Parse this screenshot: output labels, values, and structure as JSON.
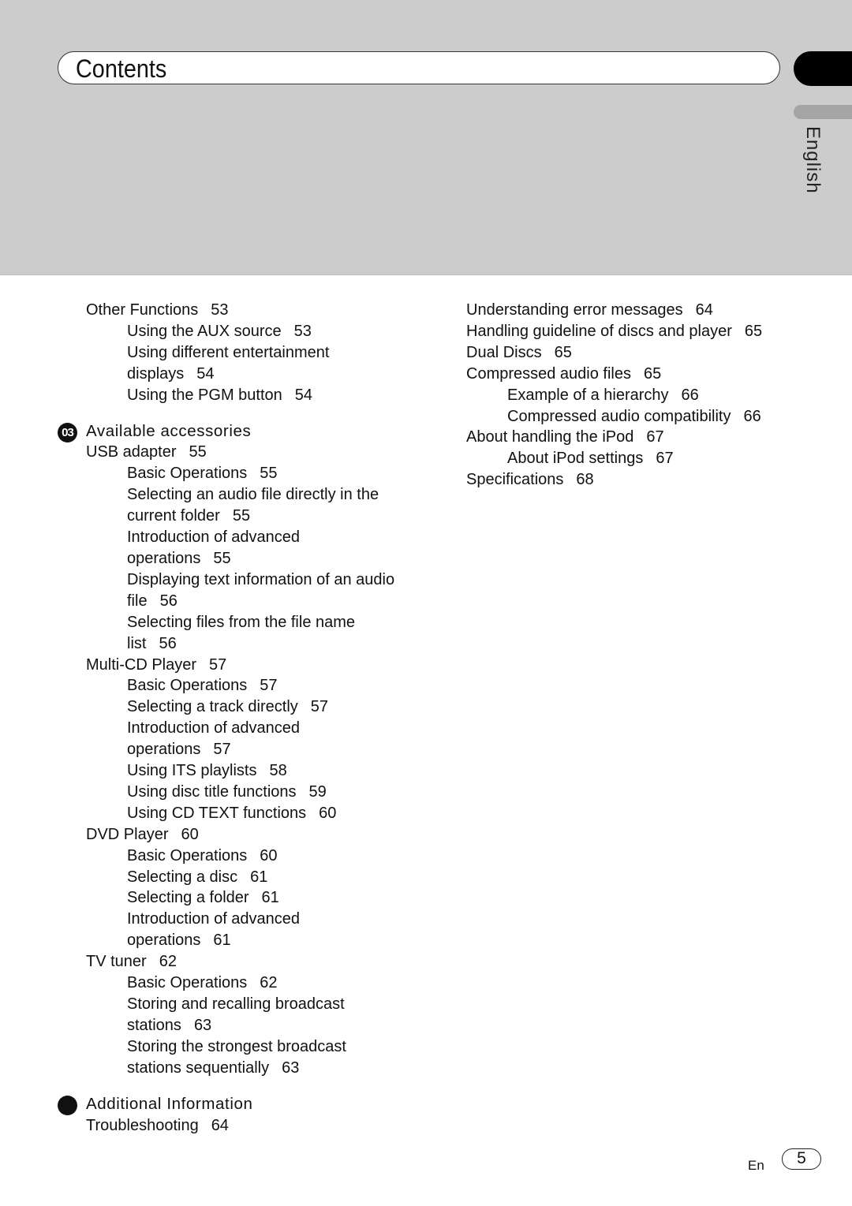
{
  "header": {
    "title": "Contents",
    "language_tab": "English"
  },
  "left_column": [
    {
      "type": "entry",
      "level": 1,
      "text": "Other Functions",
      "page": "53"
    },
    {
      "type": "entry",
      "level": 2,
      "text": "Using the AUX source",
      "page": "53"
    },
    {
      "type": "entry",
      "level": 2,
      "text": "Using different entertainment\ndisplays",
      "page": "54"
    },
    {
      "type": "entry",
      "level": 2,
      "text": "Using the PGM button",
      "page": "54"
    },
    {
      "type": "section",
      "badge": "03",
      "text": "Available accessories"
    },
    {
      "type": "entry",
      "level": 1,
      "text": "USB adapter",
      "page": "55"
    },
    {
      "type": "entry",
      "level": 2,
      "text": "Basic Operations",
      "page": "55"
    },
    {
      "type": "entry",
      "level": 2,
      "text": "Selecting an audio file directly in the\ncurrent folder",
      "page": "55"
    },
    {
      "type": "entry",
      "level": 2,
      "text": "Introduction of advanced\noperations",
      "page": "55"
    },
    {
      "type": "entry",
      "level": 2,
      "text": "Displaying text information of an audio\nfile",
      "page": "56"
    },
    {
      "type": "entry",
      "level": 2,
      "text": "Selecting files from the file name\nlist",
      "page": "56"
    },
    {
      "type": "entry",
      "level": 1,
      "text": "Multi-CD Player",
      "page": "57"
    },
    {
      "type": "entry",
      "level": 2,
      "text": "Basic Operations",
      "page": "57"
    },
    {
      "type": "entry",
      "level": 2,
      "text": "Selecting a track directly",
      "page": "57"
    },
    {
      "type": "entry",
      "level": 2,
      "text": "Introduction of advanced\noperations",
      "page": "57"
    },
    {
      "type": "entry",
      "level": 2,
      "text": "Using ITS playlists",
      "page": "58"
    },
    {
      "type": "entry",
      "level": 2,
      "text": "Using disc title functions",
      "page": "59"
    },
    {
      "type": "entry",
      "level": 2,
      "text": "Using CD TEXT functions",
      "page": "60"
    },
    {
      "type": "entry",
      "level": 1,
      "text": "DVD Player",
      "page": "60"
    },
    {
      "type": "entry",
      "level": 2,
      "text": "Basic Operations",
      "page": "60"
    },
    {
      "type": "entry",
      "level": 2,
      "text": "Selecting a disc",
      "page": "61"
    },
    {
      "type": "entry",
      "level": 2,
      "text": "Selecting a folder",
      "page": "61"
    },
    {
      "type": "entry",
      "level": 2,
      "text": "Introduction of advanced\noperations",
      "page": "61"
    },
    {
      "type": "entry",
      "level": 1,
      "text": "TV tuner",
      "page": "62"
    },
    {
      "type": "entry",
      "level": 2,
      "text": "Basic Operations",
      "page": "62"
    },
    {
      "type": "entry",
      "level": 2,
      "text": "Storing and recalling broadcast\nstations",
      "page": "63"
    },
    {
      "type": "entry",
      "level": 2,
      "text": "Storing the strongest broadcast\nstations sequentially",
      "page": "63"
    },
    {
      "type": "section",
      "badge": "",
      "text": "Additional Information"
    },
    {
      "type": "entry",
      "level": 1,
      "text": "Troubleshooting",
      "page": "64"
    }
  ],
  "right_column": [
    {
      "type": "entry",
      "level": 1,
      "text": "Understanding error messages",
      "page": "64"
    },
    {
      "type": "entry",
      "level": 1,
      "text": "Handling guideline of discs and player",
      "page": "65"
    },
    {
      "type": "entry",
      "level": 1,
      "text": "Dual Discs",
      "page": "65"
    },
    {
      "type": "entry",
      "level": 1,
      "text": "Compressed audio files",
      "page": "65"
    },
    {
      "type": "entry",
      "level": 2,
      "text": "Example of a hierarchy",
      "page": "66"
    },
    {
      "type": "entry",
      "level": 2,
      "text": "Compressed audio compatibility",
      "page": "66"
    },
    {
      "type": "entry",
      "level": 1,
      "text": "About handling the iPod",
      "page": "67"
    },
    {
      "type": "entry",
      "level": 2,
      "text": "About iPod settings",
      "page": "67"
    },
    {
      "type": "entry",
      "level": 1,
      "text": "Specifications",
      "page": "68"
    }
  ],
  "footer": {
    "language_code": "En",
    "page_number": "5"
  }
}
